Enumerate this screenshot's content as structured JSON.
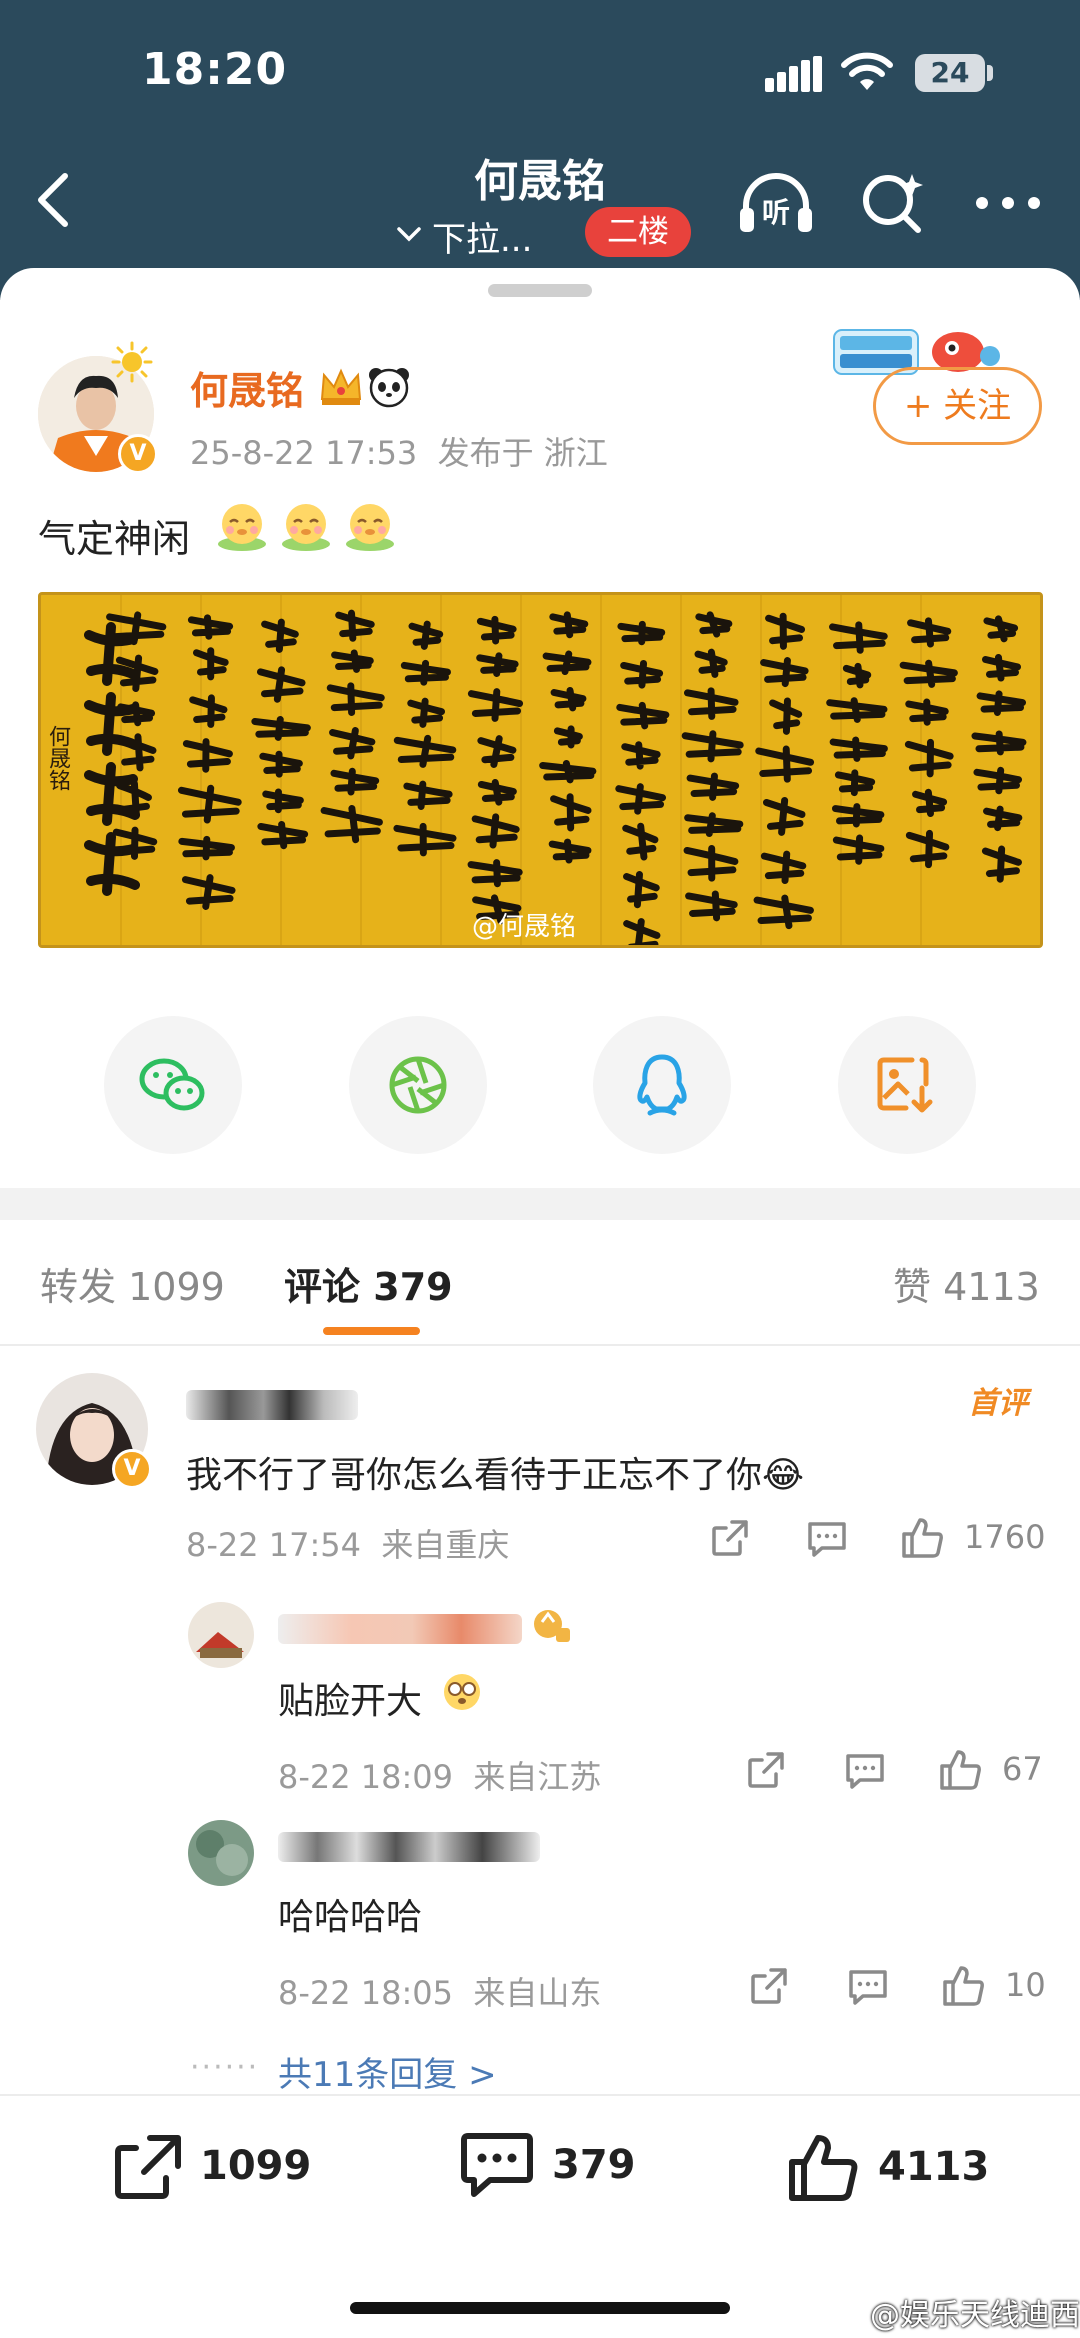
{
  "status_bar": {
    "time": "18:20",
    "battery": "24"
  },
  "nav": {
    "title": "何晟铭",
    "subtitle": "下拉...",
    "floor_badge": "二楼"
  },
  "post": {
    "author": "何晟铭",
    "timestamp": "25-8-22 17:53",
    "location": "发布于 浙江",
    "follow_label": "+ 关注",
    "text": "气定神闲",
    "image_watermark": "@何晟铭",
    "calligraphy_signature": "何晟铭",
    "share_targets": [
      "wechat-icon",
      "moments-icon",
      "qq-icon",
      "save-image-icon"
    ]
  },
  "tabs": {
    "repost_label": "转发",
    "repost_count": "1099",
    "comment_label": "评论",
    "comment_count": "379",
    "like_label": "赞",
    "like_count": "4113"
  },
  "comments": [
    {
      "badge": "首评",
      "text": "我不行了哥你怎么看待于正忘不了你😂",
      "time": "8-22 17:54",
      "from": "来自重庆",
      "likes": "1760"
    }
  ],
  "replies": [
    {
      "text": "贴脸开大",
      "time": "8-22 18:09",
      "from": "来自江苏",
      "likes": "67"
    },
    {
      "text": "哈哈哈哈",
      "time": "8-22 18:05",
      "from": "来自山东",
      "likes": "10"
    }
  ],
  "more_replies": "共11条回复 >",
  "bottom_bar": {
    "repost": "1099",
    "comment": "379",
    "like": "4113"
  },
  "corner_watermark": "@娱乐天线迪西",
  "colors": {
    "header_bg": "#2b4a5c",
    "accent_orange": "#f58220",
    "floor_red": "#e8423c",
    "link_blue": "#4b7ab5",
    "calligraphy_paper": "#e6b21a"
  }
}
